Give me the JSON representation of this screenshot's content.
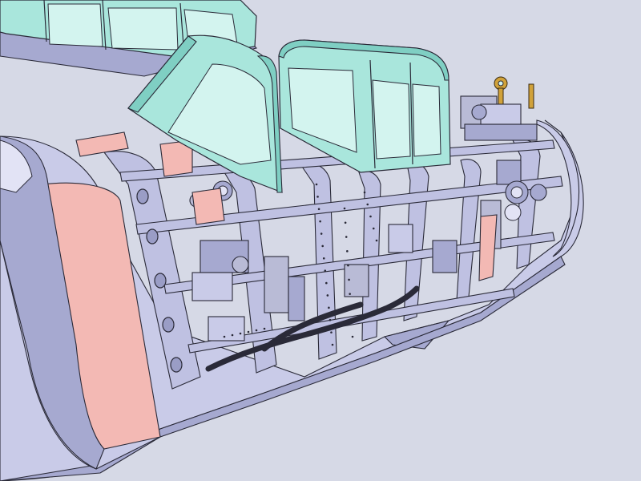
{
  "scene": {
    "subject": "cad-cutaway-aircraft-fuselage-cockpit",
    "background_color": "#d6d9e6",
    "colors": {
      "skin": "#c9cbe8",
      "skin_dark": "#a6a9d0",
      "skin_light": "#e2e3f5",
      "canopy": "#a9e6dc",
      "canopy_dark": "#7fcfc3",
      "canopy_light": "#d3f4ef",
      "panel_pink": "#f3b9b4",
      "outline": "#2a2a38",
      "metal": "#b9bbd6",
      "brass": "#d1a23a"
    }
  }
}
